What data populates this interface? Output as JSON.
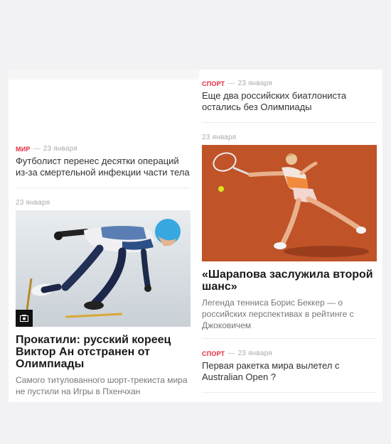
{
  "right_top": {
    "rubric": "Спорт",
    "time": "23 января",
    "title": "Еще два российских биатлониста остались без Олимпиады"
  },
  "right_photo_story": {
    "time": "23 января",
    "title": "«Шарапова заслужила второй шанс»",
    "description": "Легенда тенниса Борис Беккер — о российских перспективах в рейтинге с Джоковичем"
  },
  "right_bottom": {
    "rubric": "Спорт",
    "time": "23 января",
    "title": "Первая ракетка мира вылетел с Australian Open ?"
  },
  "left_top": {
    "rubric": "Мир",
    "time": "23 января",
    "title": "Футболист перенес десятки операций из-за смертельной инфекции части тела"
  },
  "left_photo_story": {
    "time": "23 января",
    "title": "Прокатили: русский кореец Виктор Ан отстранен от Олимпиады",
    "description": "Самого титулованного шорт-трекиста мира не пустили на Игры в Пхенчхан"
  },
  "icons": {
    "photo_badge": "gallery-icon"
  },
  "colors": {
    "rubric": "#e4283f",
    "background": "#f2f2f4",
    "court": "#c4562a"
  }
}
